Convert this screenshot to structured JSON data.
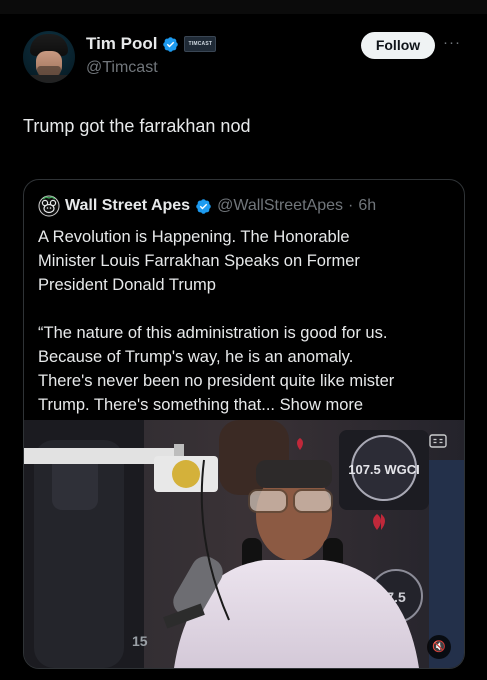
{
  "author": {
    "display_name": "Tim Pool",
    "handle": "@Timcast",
    "affiliate_badge": "TIMCAST",
    "verified_icon": "verified-badge-icon"
  },
  "actions": {
    "follow_label": "Follow",
    "more_icon": "more-horizontal-icon",
    "more_glyph": "···"
  },
  "tweet": {
    "text": "Trump got the farrakhan nod"
  },
  "quote": {
    "display_name": "Wall Street Apes",
    "handle": "@WallStreetApes",
    "separator": "·",
    "time": "6h",
    "paragraph_1": "A Revolution is Happening. The Honorable\nMinister Louis Farrakhan Speaks on Former\nPresident Donald Trump",
    "paragraph_2": "“The nature of this administration is good for us.\nBecause of Trump's way, he is an anomaly.\nThere's never been no president quite like mister\nTrump. There's something that...",
    "show_more": "Show more"
  },
  "media": {
    "station_logo": "107.5 WGCI",
    "station_logo_lower": "7.5",
    "side_number": "15",
    "mute_glyph": "🔇",
    "mute_icon": "volume-muted-icon",
    "captions_icon": "captions-icon"
  },
  "colors": {
    "background": "#000000",
    "text_primary": "#e7e9ea",
    "text_secondary": "#71767b",
    "verified_blue": "#1d9bf0",
    "follow_bg": "#eff3f4",
    "border": "#2f3336"
  }
}
